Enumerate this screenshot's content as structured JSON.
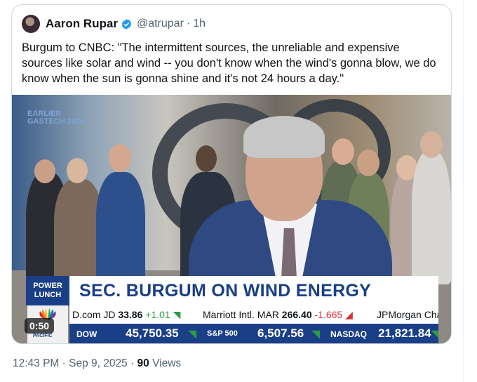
{
  "tweet": {
    "author_name": "Aaron Rupar",
    "handle": "@atrupar",
    "separator": "·",
    "time_ago": "1h",
    "text": "Burgum to CNBC: \"The intermittent sources, the unreliable and expensive sources like solar and wind -- you don't know when the wind's gonna blow, we do know when the sun is gonna shine and it's not 24 hours a day.\"",
    "posted_time": "12:43 PM",
    "posted_date": "Sep 9, 2025",
    "views_count": "90",
    "views_label": "Views"
  },
  "video": {
    "duration": "0:50",
    "overlay_tag_line1": "EARLIER",
    "overlay_tag_line2": "GASTECH 2025",
    "show_label_line1": "POWER",
    "show_label_line2": "LUNCH",
    "headline": "SEC. BURGUM ON WIND ENERGY",
    "ticker_top": [
      {
        "name": "D.com JD",
        "value": "33.86",
        "change": "+1.01",
        "direction": "up"
      },
      {
        "name": "Marriott Intl. MAR",
        "value": "266.40",
        "change": "-1.665",
        "direction": "down"
      },
      {
        "name": "JPMorgan Cha:",
        "value": "",
        "change": "",
        "direction": ""
      }
    ],
    "ticker_bottom": [
      {
        "label": "DOW",
        "value": "45,750.35"
      },
      {
        "label": "S&P 500",
        "value": "6,507.56"
      },
      {
        "label": "NASDAQ",
        "value": "21,821.84"
      }
    ],
    "network_logo_text": "PACIFIC"
  },
  "colors": {
    "verified": "#1d9bf0",
    "cnbc_blue": "#1a3f86",
    "up_green": "#2a9d45",
    "down_red": "#d6333a"
  }
}
